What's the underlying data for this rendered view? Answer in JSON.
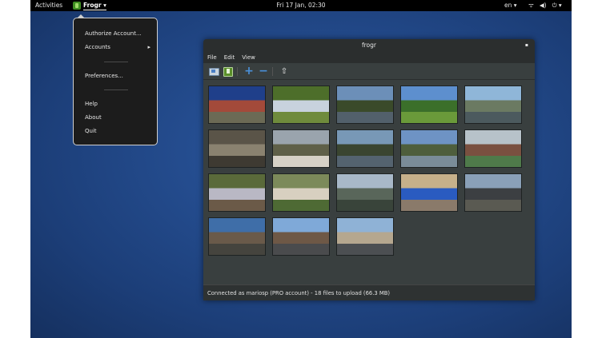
{
  "topbar": {
    "activities": "Activities",
    "app_name": "Frogr ▾",
    "clock": "Fri 17 Jan, 02:30",
    "language": "en ▾",
    "tray_icons": [
      "network-icon",
      "volume-icon",
      "power-icon"
    ],
    "tray_glyphs": [
      "ᯤ",
      "◀)",
      "⏻ ▾"
    ]
  },
  "app_menu": {
    "items": [
      {
        "label": "Authorize Account..."
      },
      {
        "label": "Accounts",
        "arrow": "▸"
      },
      {
        "label": "Preferences..."
      },
      {
        "label": "Help"
      },
      {
        "label": "About"
      },
      {
        "label": "Quit"
      }
    ]
  },
  "window": {
    "title": "frogr",
    "close_glyph": "▪",
    "menubar": [
      "File",
      "Edit",
      "View"
    ],
    "toolbar": {
      "add_glyph": "+",
      "remove_glyph": "−",
      "upload_glyph": "⇧"
    },
    "photos": [
      {
        "colors": [
          "#1f3f8a",
          "#a34a3a",
          "#6b6a55"
        ]
      },
      {
        "colors": [
          "#4d6e2a",
          "#c8d2dd",
          "#6f8b3c"
        ]
      },
      {
        "colors": [
          "#6c8fb8",
          "#3a4a2a",
          "#52606b"
        ]
      },
      {
        "colors": [
          "#5d8fce",
          "#3b6f2a",
          "#6a9a3a"
        ]
      },
      {
        "colors": [
          "#8fb6d8",
          "#6b7a62",
          "#4c5a5e"
        ]
      },
      {
        "colors": [
          "#5a5448",
          "#8a8270",
          "#3e3a32"
        ]
      },
      {
        "colors": [
          "#9aa4ad",
          "#5f6048",
          "#d6d1c6"
        ]
      },
      {
        "colors": [
          "#7898b6",
          "#3a4530",
          "#54636f"
        ]
      },
      {
        "colors": [
          "#6e93c4",
          "#4e5e3c",
          "#7a8c98"
        ]
      },
      {
        "colors": [
          "#b7c2c9",
          "#7a5040",
          "#4f7a4a"
        ]
      },
      {
        "colors": [
          "#5a6a3a",
          "#b9b8c4",
          "#6b5a48"
        ]
      },
      {
        "colors": [
          "#7c8a5a",
          "#d8d0c0",
          "#4e6a34"
        ]
      },
      {
        "colors": [
          "#a8b8c8",
          "#59665a",
          "#39443a"
        ]
      },
      {
        "colors": [
          "#c6b08a",
          "#2a5bc0",
          "#8a7a6a"
        ]
      },
      {
        "colors": [
          "#8aa0b8",
          "#3c3f42",
          "#5a5a52"
        ]
      },
      {
        "colors": [
          "#3f6ea8",
          "#6a5a4a",
          "#45443e"
        ]
      },
      {
        "colors": [
          "#7fa9d8",
          "#6e5846",
          "#4a4b4d"
        ]
      },
      {
        "colors": [
          "#8fb2d6",
          "#b5a78f",
          "#4c4f52"
        ]
      }
    ],
    "status": "Connected as mariosp (PRO account) - 18 files to upload (66.3 MB)"
  }
}
